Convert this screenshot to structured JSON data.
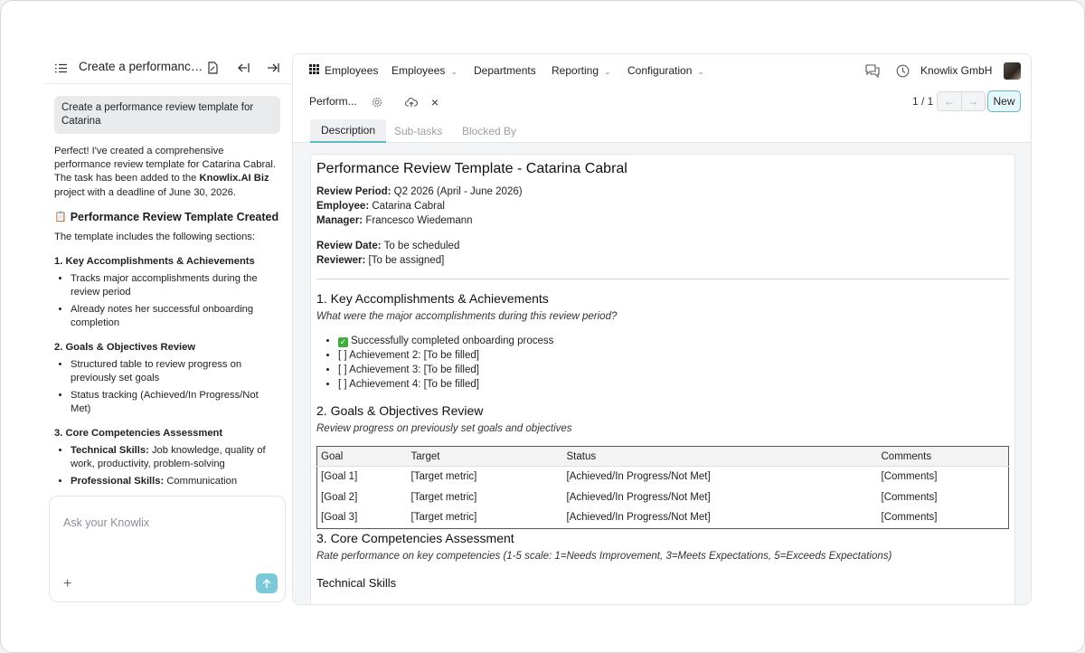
{
  "assistant": {
    "title": "Create a performance review template for Catarina",
    "user_message": "Create a performance review template for Catarina",
    "reply_intro_1": "Perfect! I've created a comprehensive performance review template for Catarina Cabral. The task has been added to the ",
    "reply_project": "Knowlix.AI Biz",
    "reply_intro_2": " project with a deadline of June 30, 2026.",
    "created_heading_icon": "📋",
    "created_heading": "Performance Review Template Created",
    "sections_intro": "The template includes the following sections:",
    "sections": [
      {
        "title": "1. Key Accomplishments & Achievements",
        "bullets": [
          "Tracks major accomplishments during the review period",
          "Already notes her successful onboarding completion"
        ]
      },
      {
        "title": "2. Goals & Objectives Review",
        "bullets": [
          "Structured table to review progress on previously set goals",
          "Status tracking (Achieved/In Progress/Not Met)"
        ]
      },
      {
        "title": "3. Core Competencies Assessment",
        "bullets_rich": [
          {
            "bold": "Technical Skills:",
            "text": " Job knowledge, quality of work, productivity, problem-solving"
          },
          {
            "bold": "Professional Skills:",
            "text": " Communication"
          }
        ]
      }
    ],
    "composer_placeholder": "Ask your Knowlix",
    "icons": [
      "list-icon",
      "new-chat-icon",
      "collapse-left-icon",
      "expand-right-icon",
      "plus-icon",
      "send-arrow-icon"
    ]
  },
  "app": {
    "nav": {
      "app_name": "Employees",
      "menus": [
        "Employees",
        "Departments",
        "Reporting",
        "Configuration"
      ],
      "company": "Knowlix GmbH"
    },
    "control": {
      "breadcrumb": "Perform...",
      "pager": "1 / 1",
      "new_label": "New"
    },
    "tabs": [
      "Description",
      "Sub-tasks",
      "Blocked By"
    ],
    "doc": {
      "title": "Performance Review Template - Catarina Cabral",
      "review_period_label": "Review Period:",
      "review_period": " Q2 2026 (April - June 2026)",
      "employee_label": "Employee:",
      "employee": " Catarina Cabral",
      "manager_label": "Manager:",
      "manager": " Francesco Wiedemann",
      "review_date_label": "Review Date:",
      "review_date": " To be scheduled",
      "reviewer_label": "Reviewer:",
      "reviewer": " [To be assigned]",
      "s1_title": "1. Key Accomplishments & Achievements",
      "s1_prompt": "What were the major accomplishments during this review period?",
      "s1_items": [
        "Successfully completed onboarding process",
        "[ ] Achievement 2: [To be filled]",
        "[ ] Achievement 3: [To be filled]",
        "[ ] Achievement 4: [To be filled]"
      ],
      "s2_title": "2. Goals & Objectives Review",
      "s2_prompt": "Review progress on previously set goals and objectives",
      "goals_table": {
        "headers": [
          "Goal",
          "Target",
          "Status",
          "Comments"
        ],
        "rows": [
          [
            "[Goal 1]",
            "[Target metric]",
            "[Achieved/In Progress/Not Met]",
            "[Comments]"
          ],
          [
            "[Goal 2]",
            "[Target metric]",
            "[Achieved/In Progress/Not Met]",
            "[Comments]"
          ],
          [
            "[Goal 3]",
            "[Target metric]",
            "[Achieved/In Progress/Not Met]",
            "[Comments]"
          ]
        ]
      },
      "s3_title": "3. Core Competencies Assessment",
      "s3_prompt": "Rate performance on key competencies (1-5 scale: 1=Needs Improvement, 3=Meets Expectations, 5=Exceeds Expectations)",
      "s3_sub": "Technical Skills"
    }
  },
  "colors": {
    "accent": "#5fb7c8",
    "send": "#7cc9d9",
    "check": "#3fae3f"
  }
}
